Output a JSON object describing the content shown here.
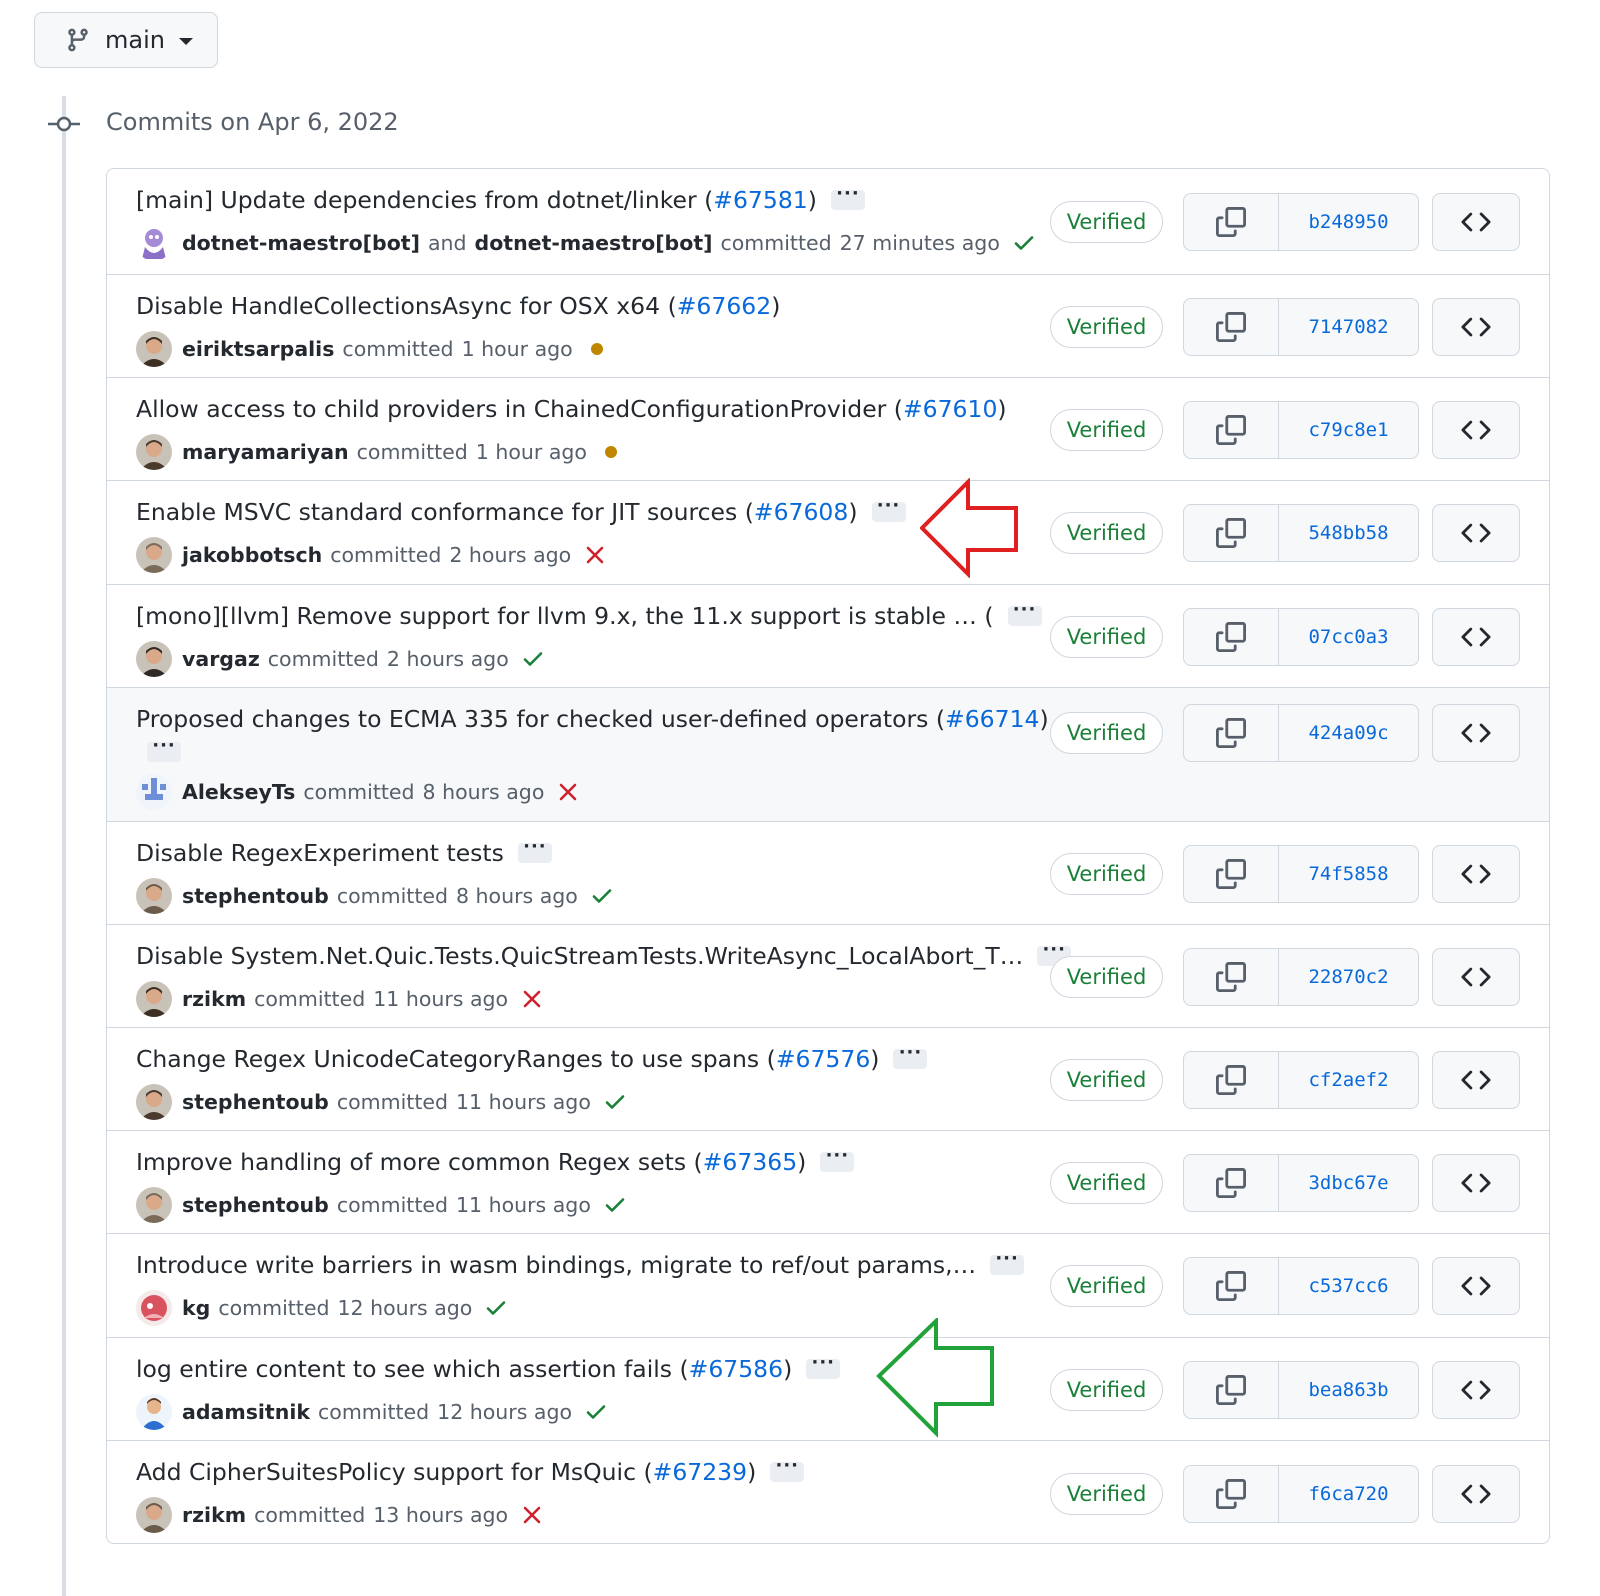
{
  "branch": {
    "name": "main"
  },
  "group": {
    "title": "Commits on Apr 6, 2022"
  },
  "labels": {
    "committed": "committed",
    "and": "and",
    "verified": "Verified"
  },
  "colors": {
    "success": "#1a7f37",
    "pending": "#bf8700",
    "failure": "#cf222e",
    "link": "#0969da",
    "annotation_red": "#e02020",
    "annotation_green": "#22a33a"
  },
  "commits": [
    {
      "title": "[main] Update dependencies from dotnet/linker",
      "pr": "#67581",
      "open": " (",
      "close": ")",
      "ellipsis": true,
      "author": "dotnet-maestro[bot]",
      "coauthor": "dotnet-maestro[bot]",
      "time": "27 minutes ago",
      "status": "success",
      "sha": "b248950",
      "avatar": "bot-avatar"
    },
    {
      "title": "Disable HandleCollectionsAsync for OSX x64",
      "pr": "#67662",
      "open": " (",
      "close": ")",
      "ellipsis": false,
      "author": "eiriktsarpalis",
      "time": "1 hour ago",
      "status": "pending",
      "sha": "7147082",
      "avatar": "user-avatar"
    },
    {
      "title": "Allow access to child providers in ChainedConfigurationProvider",
      "pr": "#67610",
      "open": " (",
      "close": ")",
      "ellipsis": false,
      "author": "maryamariyan",
      "time": "1 hour ago",
      "status": "pending",
      "sha": "c79c8e1",
      "avatar": "user-avatar"
    },
    {
      "title": "Enable MSVC standard conformance for JIT sources",
      "pr": "#67608",
      "open": " (",
      "close": ")",
      "ellipsis": true,
      "author": "jakobbotsch",
      "time": "2 hours ago",
      "status": "failure",
      "sha": "548bb58",
      "avatar": "user-avatar"
    },
    {
      "title": "[mono][llvm] Remove support for llvm 9.x, the 11.x support is stable … (",
      "pr": "",
      "open": "",
      "close": "",
      "ellipsis": true,
      "author": "vargaz",
      "time": "2 hours ago",
      "status": "success",
      "sha": "07cc0a3",
      "avatar": "user-avatar"
    },
    {
      "title": "Proposed changes to ECMA 335 for checked user-defined operators",
      "pr": "#66714",
      "open": " (",
      "close": ")",
      "ellipsis": true,
      "author": "AlekseyTs",
      "time": "8 hours ago",
      "status": "failure",
      "sha": "424a09c",
      "avatar": "identicon-avatar"
    },
    {
      "title": "Disable RegexExperiment tests",
      "pr": "",
      "open": "",
      "close": "",
      "ellipsis": true,
      "author": "stephentoub",
      "time": "8 hours ago",
      "status": "success",
      "sha": "74f5858",
      "avatar": "user-avatar"
    },
    {
      "title": "Disable System.Net.Quic.Tests.QuicStreamTests.WriteAsync_LocalAbort_T…",
      "pr": "",
      "open": "",
      "close": "",
      "ellipsis": true,
      "author": "rzikm",
      "time": "11 hours ago",
      "status": "failure",
      "sha": "22870c2",
      "avatar": "user-avatar"
    },
    {
      "title": "Change Regex UnicodeCategoryRanges to use spans",
      "pr": "#67576",
      "open": " (",
      "close": ")",
      "ellipsis": true,
      "author": "stephentoub",
      "time": "11 hours ago",
      "status": "success",
      "sha": "cf2aef2",
      "avatar": "user-avatar"
    },
    {
      "title": "Improve handling of more common Regex sets",
      "pr": "#67365",
      "open": " (",
      "close": ")",
      "ellipsis": true,
      "author": "stephentoub",
      "time": "11 hours ago",
      "status": "success",
      "sha": "3dbc67e",
      "avatar": "user-avatar"
    },
    {
      "title": "Introduce write barriers in wasm bindings, migrate to ref/out params,…",
      "pr": "",
      "open": "",
      "close": "",
      "ellipsis": true,
      "author": "kg",
      "time": "12 hours ago",
      "status": "success",
      "sha": "c537cc6",
      "avatar": "user-avatar"
    },
    {
      "title": "log entire content to see which assertion fails",
      "pr": "#67586",
      "open": " (",
      "close": ")",
      "ellipsis": true,
      "author": "adamsitnik",
      "time": "12 hours ago",
      "status": "success",
      "sha": "bea863b",
      "avatar": "user-avatar"
    },
    {
      "title": "Add CipherSuitesPolicy support for MsQuic",
      "pr": "#67239",
      "open": " (",
      "close": ")",
      "ellipsis": true,
      "author": "rzikm",
      "time": "13 hours ago",
      "status": "failure",
      "sha": "f6ca720",
      "avatar": "user-avatar"
    }
  ],
  "annotations": [
    {
      "icon": "left-arrow-icon",
      "color": "red"
    },
    {
      "icon": "left-arrow-icon",
      "color": "green"
    }
  ]
}
